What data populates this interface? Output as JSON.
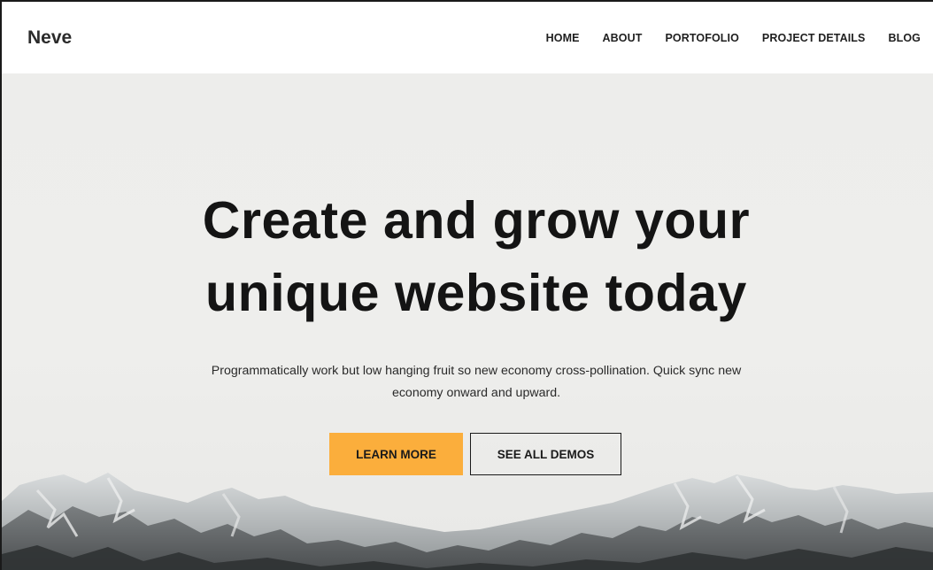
{
  "header": {
    "logo": "Neve",
    "nav": [
      {
        "label": "HOME"
      },
      {
        "label": "ABOUT"
      },
      {
        "label": "PORTOFOLIO"
      },
      {
        "label": "PROJECT DETAILS"
      },
      {
        "label": "BLOG"
      }
    ]
  },
  "hero": {
    "headline_line1": "Create and grow your",
    "headline_line2": "unique website today",
    "subtext_line1": "Programmatically work but low hanging fruit so new economy cross-pollination. Quick sync new",
    "subtext_line2": "economy onward and upward.",
    "primary_button": "LEARN MORE",
    "secondary_button": "SEE ALL DEMOS"
  },
  "colors": {
    "accent": "#fbae3c",
    "hero_background": "#eeeeec",
    "text": "#141414"
  }
}
